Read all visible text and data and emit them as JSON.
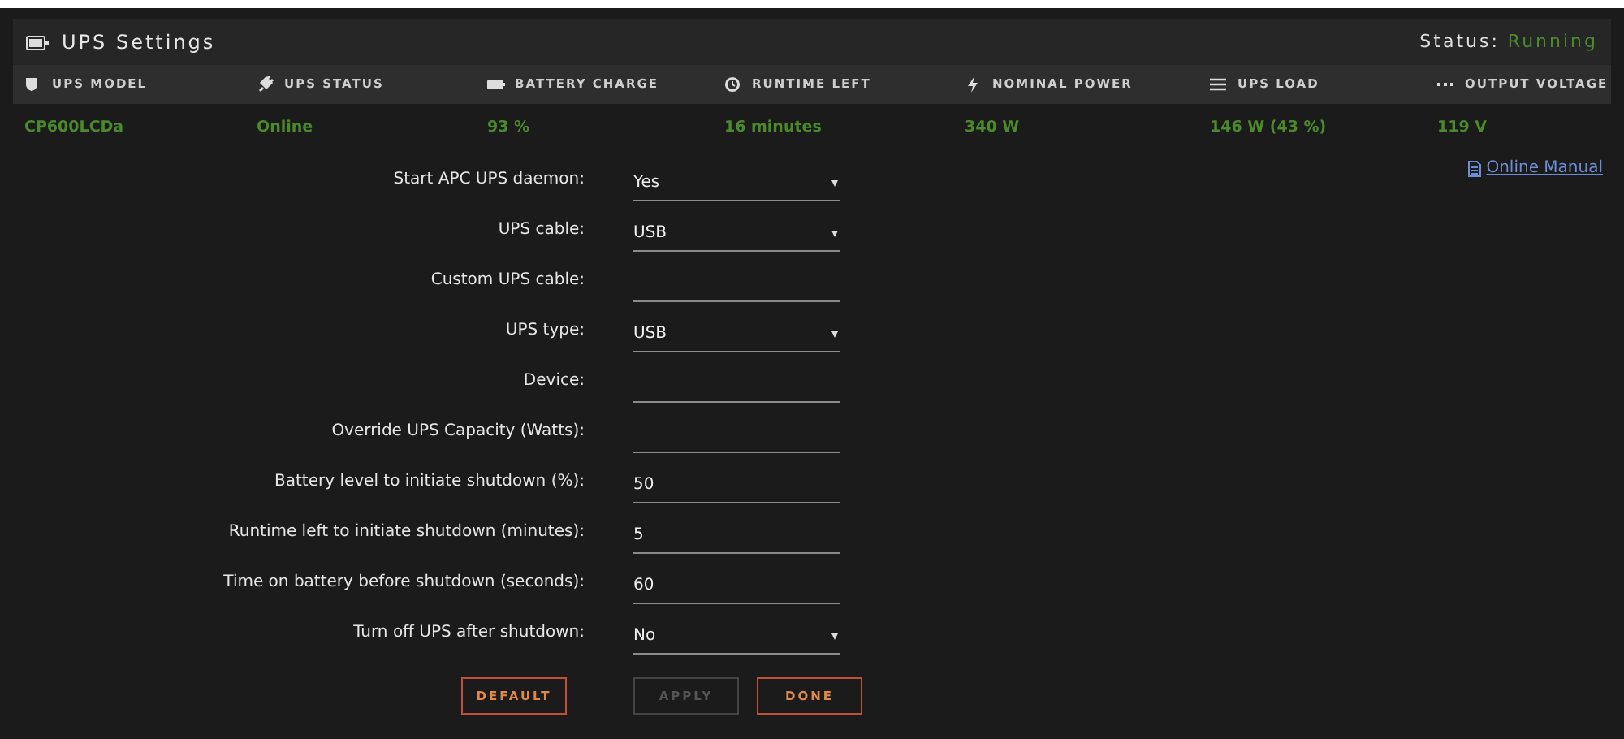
{
  "panel": {
    "title": "UPS Settings",
    "status_label": "Status:",
    "status_value": "Running"
  },
  "columns": [
    {
      "label": "UPS MODEL",
      "value": "CP600LCDa"
    },
    {
      "label": "UPS STATUS",
      "value": "Online"
    },
    {
      "label": "BATTERY CHARGE",
      "value": "93 %"
    },
    {
      "label": "RUNTIME LEFT",
      "value": "16 minutes"
    },
    {
      "label": "NOMINAL POWER",
      "value": "340 W"
    },
    {
      "label": "UPS LOAD",
      "value": "146 W (43 %)"
    },
    {
      "label": "OUTPUT VOLTAGE",
      "value": "119 V"
    }
  ],
  "manual_link": "Online Manual",
  "fields": [
    {
      "label": "Start APC UPS daemon:",
      "kind": "select",
      "value": "Yes"
    },
    {
      "label": "UPS cable:",
      "kind": "select",
      "value": "USB"
    },
    {
      "label": "Custom UPS cable:",
      "kind": "input"
    },
    {
      "label": "UPS type:",
      "kind": "select",
      "value": "USB"
    },
    {
      "label": "Device:",
      "kind": "input"
    },
    {
      "label": "Override UPS Capacity (Watts):",
      "kind": "input"
    },
    {
      "label": "Battery level to initiate shutdown (%):",
      "kind": "input",
      "value": "50"
    },
    {
      "label": "Runtime left to initiate shutdown (minutes):",
      "kind": "input",
      "value": "5"
    },
    {
      "label": "Time on battery before shutdown (seconds):",
      "kind": "input",
      "value": "60"
    },
    {
      "label": "Turn off UPS after shutdown:",
      "kind": "select",
      "value": "No"
    }
  ],
  "buttons": [
    {
      "label": "DEFAULT",
      "disabled": false
    },
    {
      "label": "APPLY",
      "disabled": true
    },
    {
      "label": "DONE",
      "disabled": false
    }
  ]
}
